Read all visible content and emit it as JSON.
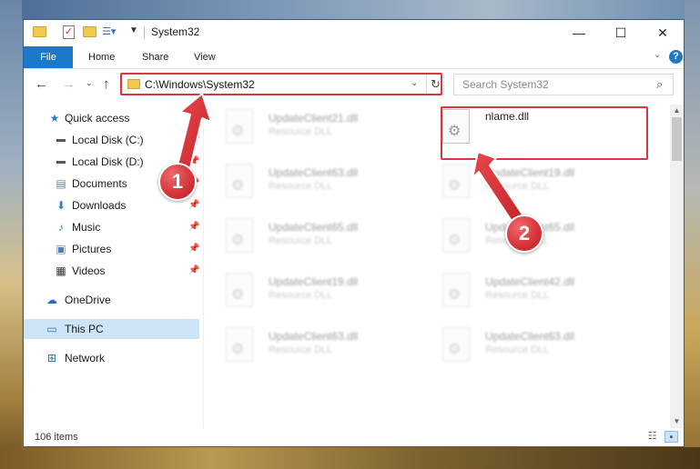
{
  "window": {
    "title": "System32",
    "controls": {
      "minimize": "—",
      "maximize": "☐",
      "close": "✕"
    }
  },
  "ribbon": {
    "tabs": [
      "File",
      "Home",
      "Share",
      "View"
    ]
  },
  "address_bar": {
    "path": "C:\\Windows\\System32"
  },
  "search": {
    "placeholder": "Search System32"
  },
  "nav_pane": {
    "items": [
      {
        "label": "Quick access",
        "icon": "star-icon"
      },
      {
        "label": "Local Disk (C:)",
        "icon": "drive-icon"
      },
      {
        "label": "Local Disk (D:)",
        "icon": "drive-icon"
      },
      {
        "label": "Documents",
        "icon": "documents-icon"
      },
      {
        "label": "Downloads",
        "icon": "download-icon"
      },
      {
        "label": "Music",
        "icon": "music-icon"
      },
      {
        "label": "Pictures",
        "icon": "pictures-icon"
      },
      {
        "label": "Videos",
        "icon": "videos-icon"
      },
      {
        "label": "OneDrive",
        "icon": "cloud-icon"
      },
      {
        "label": "This PC",
        "icon": "computer-icon"
      },
      {
        "label": "Network",
        "icon": "network-icon"
      }
    ],
    "selected": "This PC"
  },
  "files": [
    {
      "name": "UpdateClient21.dll",
      "type": "Resource DLL",
      "blurred": true
    },
    {
      "name": "nlame.dll",
      "type": "",
      "blurred": false
    },
    {
      "name": "UpdateClient63.dll",
      "type": "Resource DLL",
      "blurred": true
    },
    {
      "name": "UpdateClient19.dll",
      "type": "Resource DLL",
      "blurred": true
    },
    {
      "name": "UpdateClient65.dll",
      "type": "Resource DLL",
      "blurred": true
    },
    {
      "name": "UpdateClient65.dll",
      "type": "Resource DLL",
      "blurred": true
    },
    {
      "name": "UpdateClient19.dll",
      "type": "Resource DLL",
      "blurred": true
    },
    {
      "name": "UpdateClient42.dll",
      "type": "Resource DLL",
      "blurred": true
    },
    {
      "name": "UpdateClient63.dll",
      "type": "Resource DLL",
      "blurred": true
    },
    {
      "name": "UpdateClient63.dll",
      "type": "Resource DLL",
      "blurred": true
    }
  ],
  "status_bar": {
    "item_count": "106 items"
  },
  "callouts": [
    "1",
    "2"
  ],
  "colors": {
    "accent": "#1979ca",
    "highlight": "#d9363e",
    "selection": "#cde4f7"
  }
}
